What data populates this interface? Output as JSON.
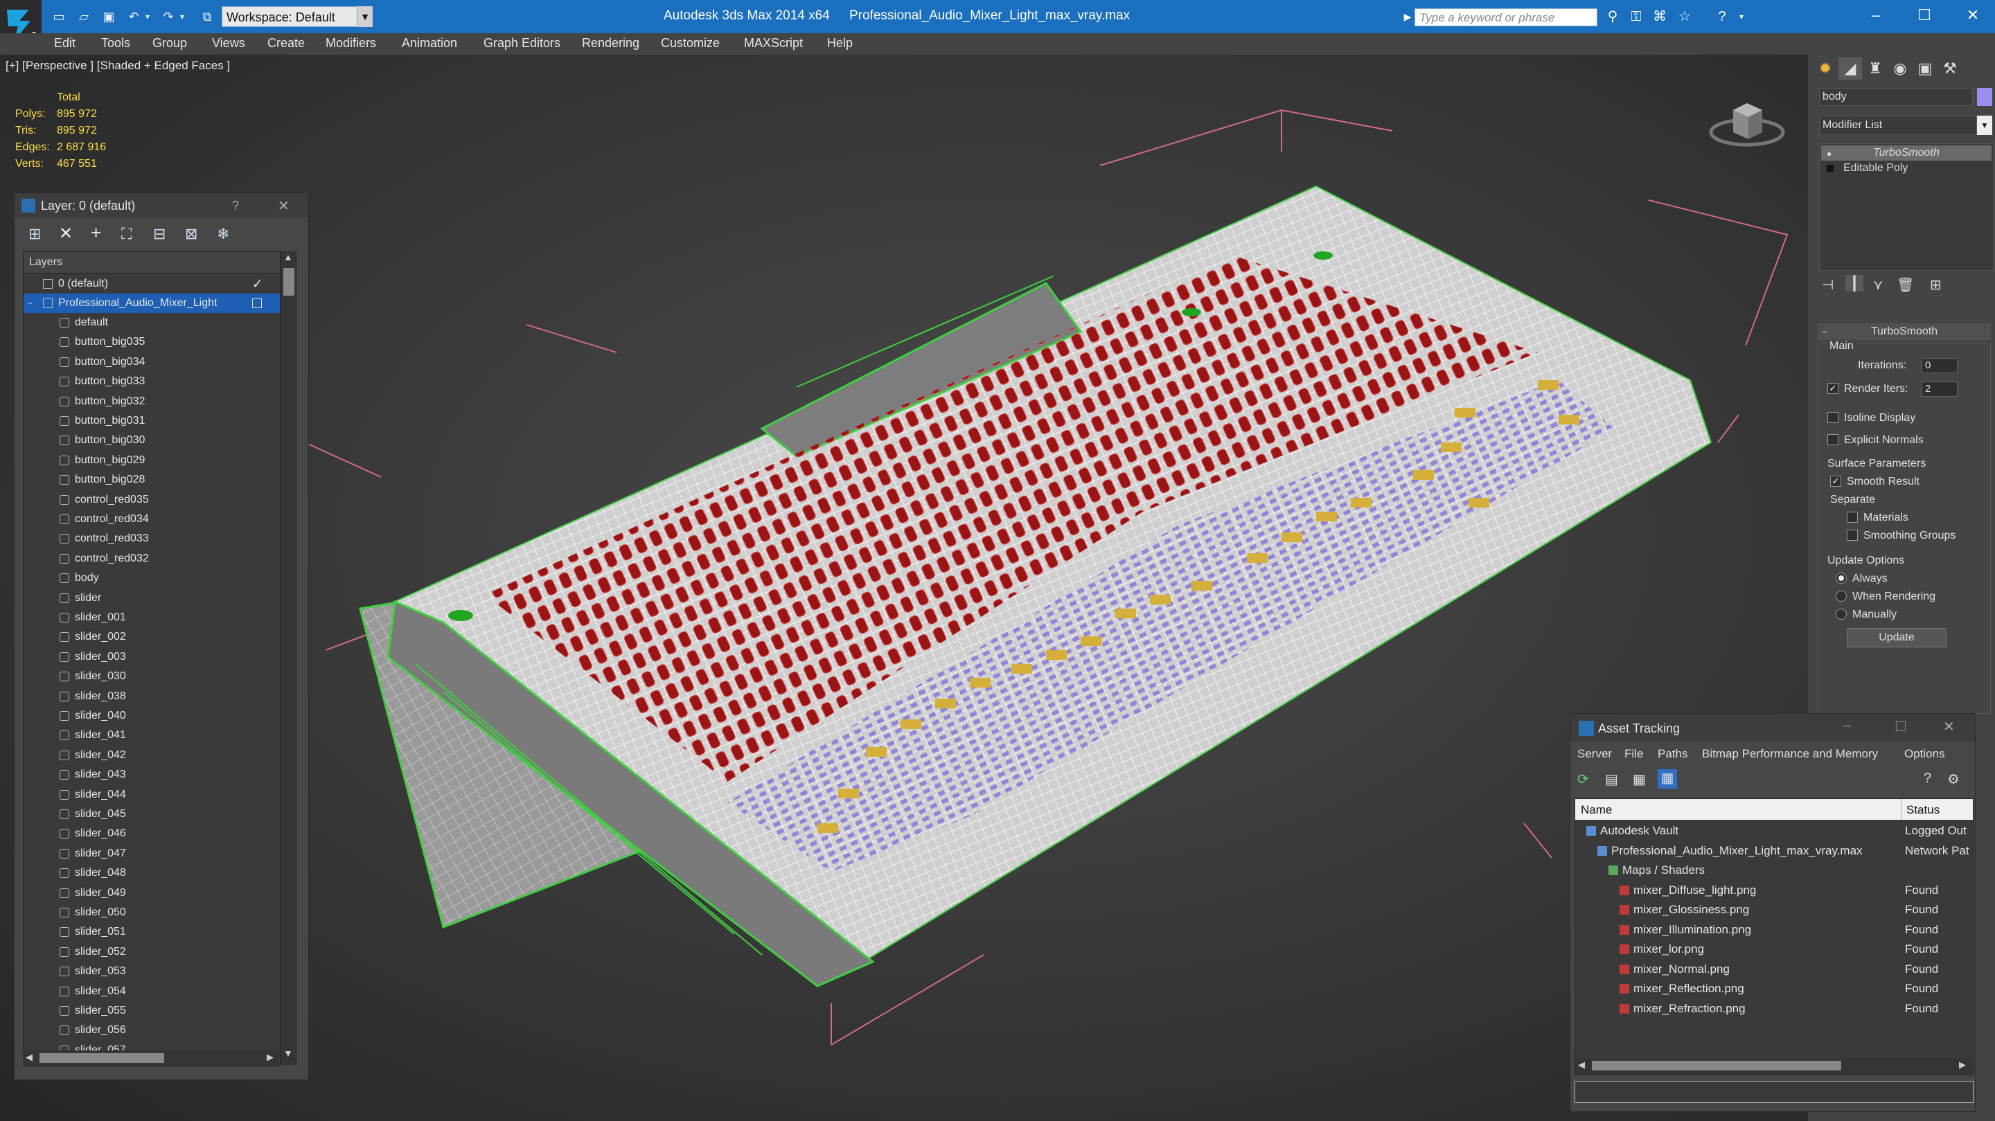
{
  "app": {
    "title": "Autodesk 3ds Max  2014 x64",
    "file": "Professional_Audio_Mixer_Light_max_vray.max",
    "workspace": "Workspace: Default",
    "search_placeholder": "Type a keyword or phrase"
  },
  "menu": [
    "Edit",
    "Tools",
    "Group",
    "Views",
    "Create",
    "Modifiers",
    "Animation",
    "Graph Editors",
    "Rendering",
    "Customize",
    "MAXScript",
    "Help"
  ],
  "viewport": {
    "label": "[+] [Perspective ] [Shaded + Edged Faces ]",
    "stats": {
      "header": "Total",
      "rows": [
        {
          "k": "Polys:",
          "v": "895 972"
        },
        {
          "k": "Tris:",
          "v": "895 972"
        },
        {
          "k": "Edges:",
          "v": "2 687 916"
        },
        {
          "k": "Verts:",
          "v": "467 551"
        }
      ]
    }
  },
  "layer_dialog": {
    "title": "Layer: 0 (default)",
    "help": "?",
    "close": "✕",
    "column": "Layers",
    "layers": [
      {
        "name": "0 (default)",
        "level": 1,
        "checked": true
      },
      {
        "name": "Professional_Audio_Mixer_Light",
        "level": 1,
        "selected": true
      }
    ],
    "objects": [
      "default",
      "button_big035",
      "button_big034",
      "button_big033",
      "button_big032",
      "button_big031",
      "button_big030",
      "button_big029",
      "button_big028",
      "control_red035",
      "control_red034",
      "control_red033",
      "control_red032",
      "body",
      "slider",
      "slider_001",
      "slider_002",
      "slider_003",
      "slider_030",
      "slider_038",
      "slider_040",
      "slider_041",
      "slider_042",
      "slider_043",
      "slider_044",
      "slider_045",
      "slider_046",
      "slider_047",
      "slider_048",
      "slider_049",
      "slider_050",
      "slider_051",
      "slider_052",
      "slider_053",
      "slider_054",
      "slider_055",
      "slider_056",
      "slider_057"
    ]
  },
  "command_panel": {
    "object_name": "body",
    "modifier_list": "Modifier List",
    "stack": [
      "TurboSmooth",
      "Editable Poly"
    ],
    "rollout": "TurboSmooth",
    "main": "Main",
    "iterations_label": "Iterations:",
    "iterations": "0",
    "render_iters_label": "Render Iters:",
    "render_iters": "2",
    "isoline": "Isoline Display",
    "explicit_normals": "Explicit Normals",
    "surface_params": "Surface Parameters",
    "smooth_result": "Smooth Result",
    "separate": "Separate",
    "materials": "Materials",
    "smoothing_groups": "Smoothing Groups",
    "update_options": "Update Options",
    "always": "Always",
    "when_rendering": "When Rendering",
    "manually": "Manually",
    "update_btn": "Update"
  },
  "asset_tracking": {
    "title": "Asset Tracking",
    "menu": [
      "Server",
      "File",
      "Paths",
      "Bitmap Performance and Memory",
      "Options"
    ],
    "col_name": "Name",
    "col_status": "Status",
    "rows": [
      {
        "name": "Autodesk Vault",
        "status": "Logged Out",
        "indent": 1
      },
      {
        "name": "Professional_Audio_Mixer_Light_max_vray.max",
        "status": "Network Pat",
        "indent": 2
      },
      {
        "name": "Maps / Shaders",
        "status": "",
        "indent": 3
      },
      {
        "name": "mixer_Diffuse_light.png",
        "status": "Found",
        "indent": 4
      },
      {
        "name": "mixer_Glossiness.png",
        "status": "Found",
        "indent": 4
      },
      {
        "name": "mixer_Illumination.png",
        "status": "Found",
        "indent": 4
      },
      {
        "name": "mixer_lor.png",
        "status": "Found",
        "indent": 4
      },
      {
        "name": "mixer_Normal.png",
        "status": "Found",
        "indent": 4
      },
      {
        "name": "mixer_Reflection.png",
        "status": "Found",
        "indent": 4
      },
      {
        "name": "mixer_Refraction.png",
        "status": "Found",
        "indent": 4
      }
    ]
  },
  "colors": {
    "accent": "#1b6fbf",
    "selection": "#1e5fb3",
    "stats": "#ffdf4a",
    "wire_green": "#3fd03f",
    "knob_red": "#9a1515",
    "wire_white": "#e8e8e8"
  }
}
